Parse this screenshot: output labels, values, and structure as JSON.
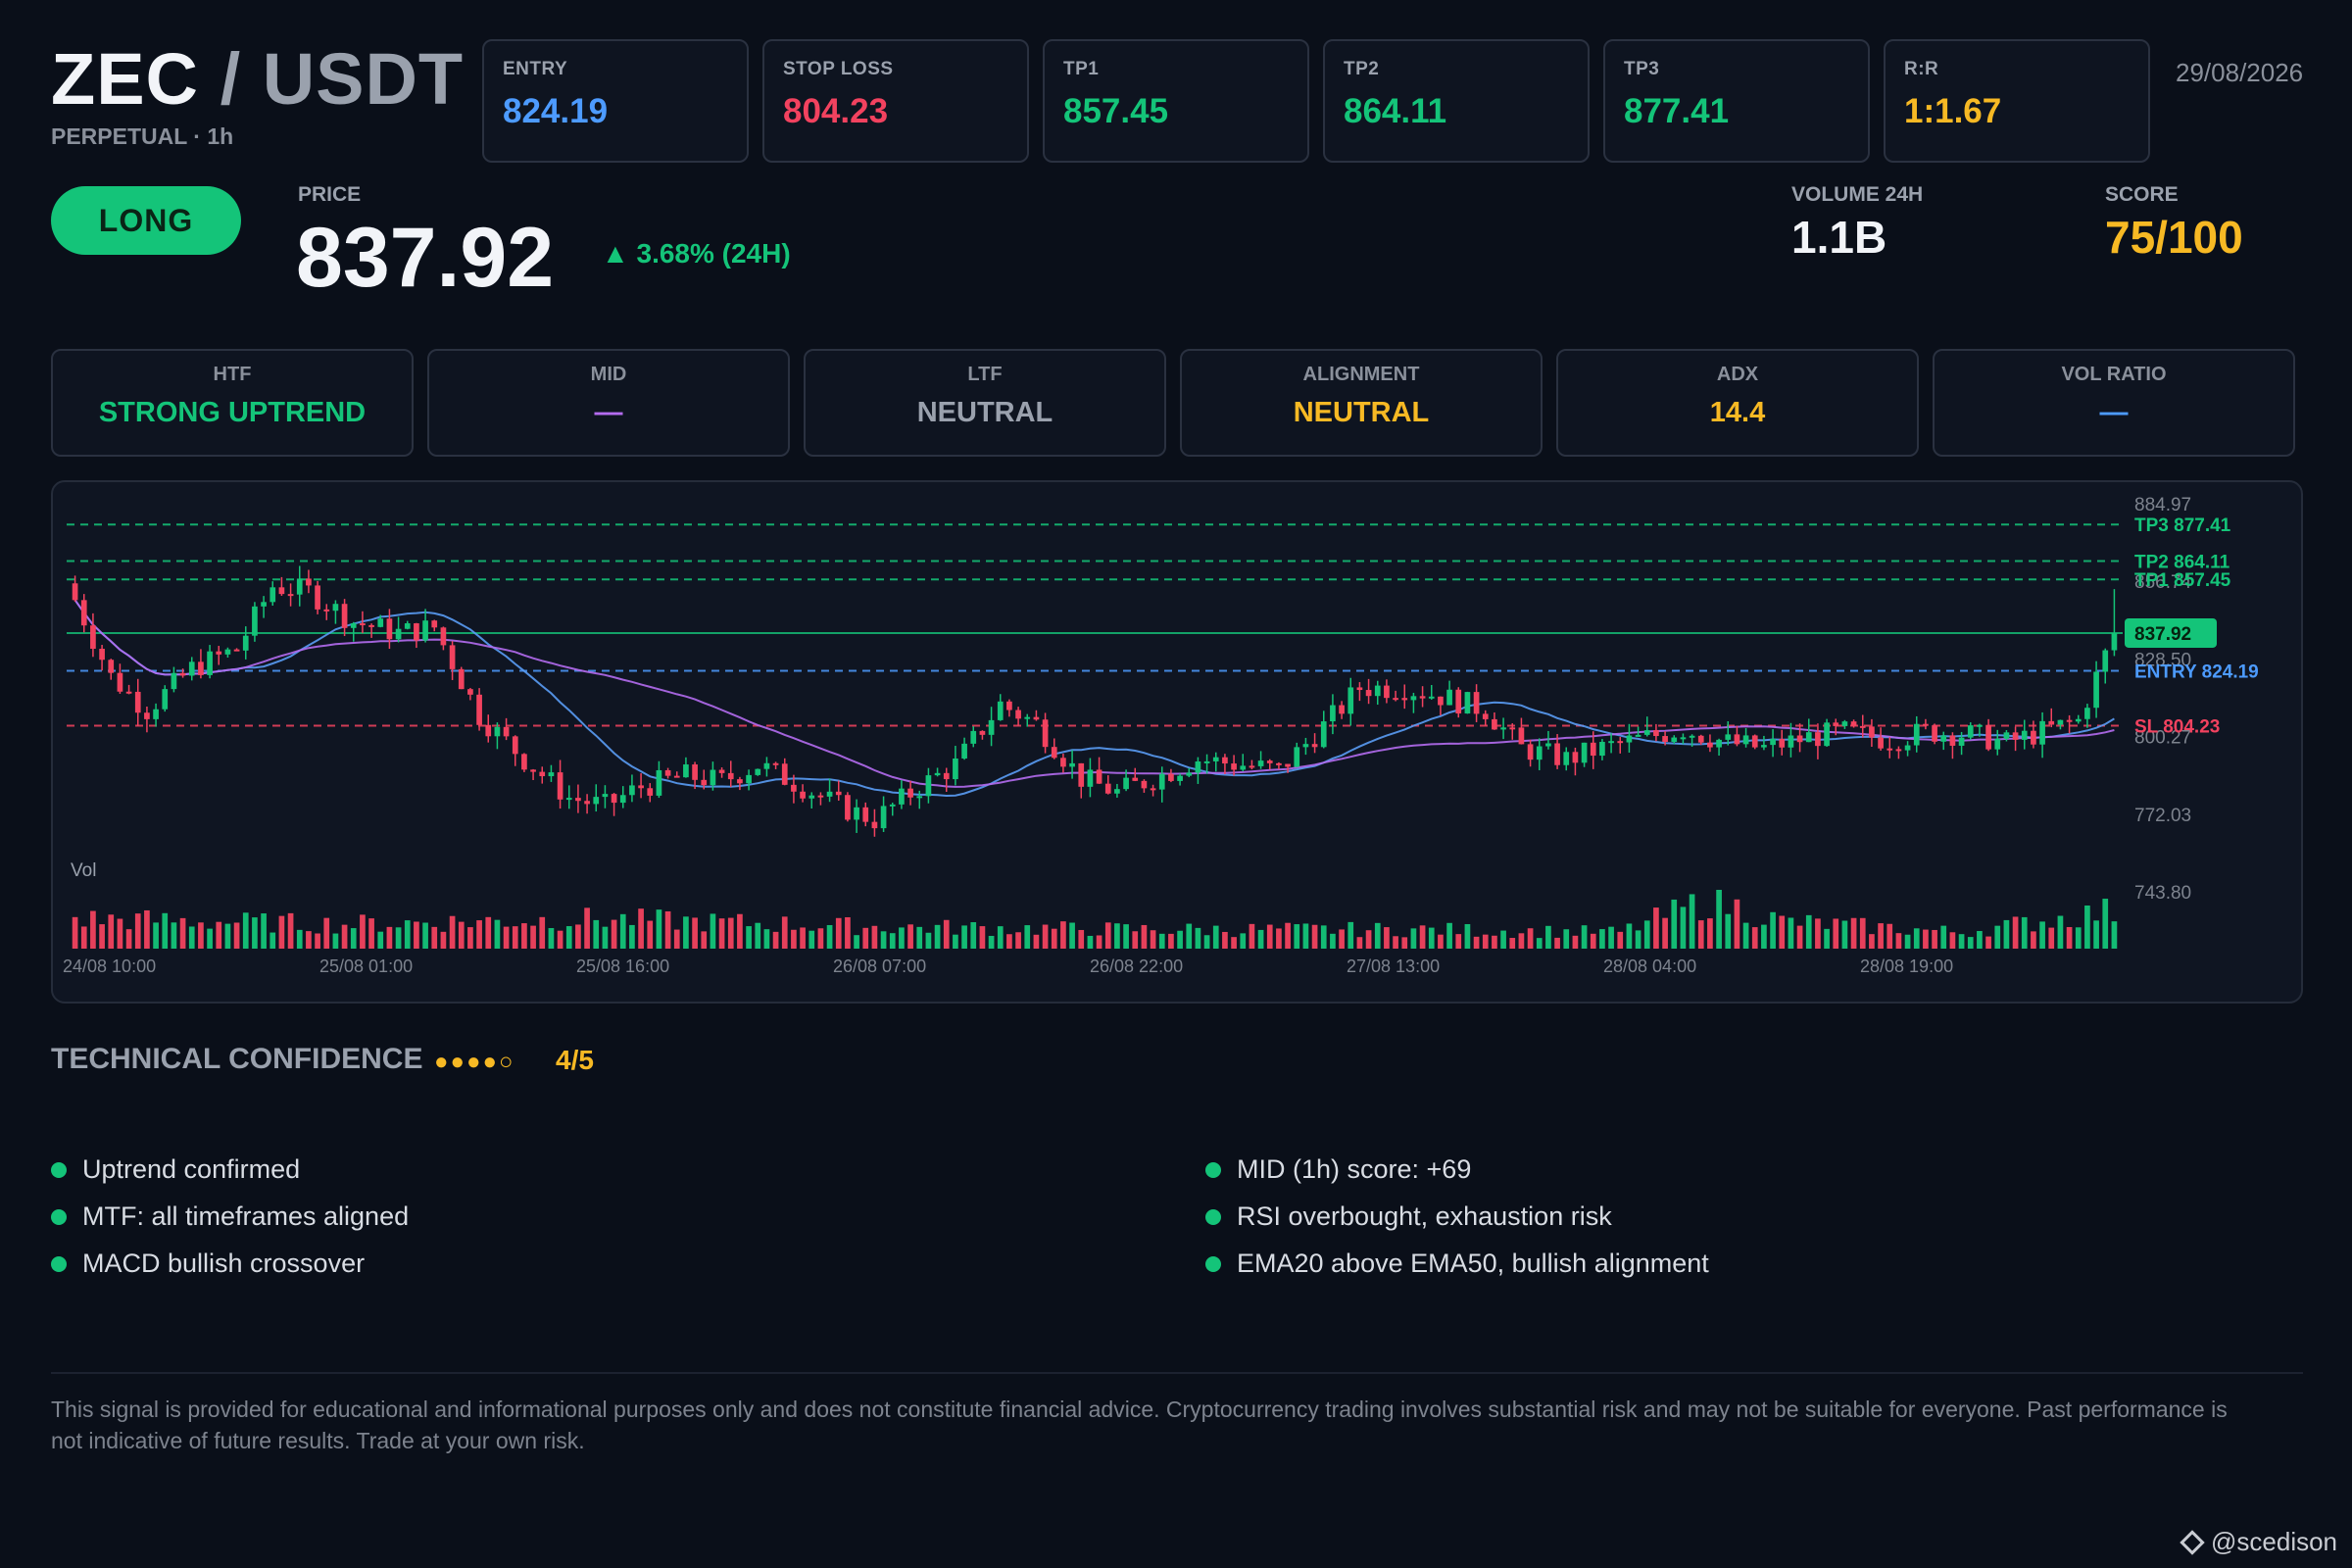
{
  "header": {
    "base": "ZEC",
    "separator": "/",
    "quote": "USDT",
    "subtitle": "PERPETUAL · 1h",
    "date": "29/08/2026"
  },
  "levels": [
    {
      "label": "ENTRY",
      "value": "824.19",
      "color": "#4d9bff"
    },
    {
      "label": "STOP LOSS",
      "value": "804.23",
      "color": "#f2425f"
    },
    {
      "label": "TP1",
      "value": "857.45",
      "color": "#14c479"
    },
    {
      "label": "TP2",
      "value": "864.11",
      "color": "#14c479"
    },
    {
      "label": "TP3",
      "value": "877.41",
      "color": "#14c479"
    },
    {
      "label": "R:R",
      "value": "1:1.67",
      "color": "#f7b924"
    }
  ],
  "signal": {
    "direction": "LONG",
    "price_label": "PRICE",
    "price": "837.92",
    "change": "▲ 3.68% (24H)",
    "volume_label": "VOLUME 24H",
    "volume": "1.1B",
    "score_label": "SCORE",
    "score": "75/100"
  },
  "indicators": [
    {
      "label": "HTF",
      "value": "STRONG UPTREND",
      "color": "#14c479"
    },
    {
      "label": "MID",
      "value": "—",
      "color": "#b46cf0"
    },
    {
      "label": "LTF",
      "value": "NEUTRAL",
      "color": "#9aa1ad"
    },
    {
      "label": "ALIGNMENT",
      "value": "NEUTRAL",
      "color": "#f7b924"
    },
    {
      "label": "ADX",
      "value": "14.4",
      "color": "#f7b924"
    },
    {
      "label": "VOL RATIO",
      "value": "—",
      "color": "#4d9bff"
    }
  ],
  "chart_data": {
    "type": "candlestick",
    "y_axis_ticks": [
      "884.97",
      "856.74",
      "828.50",
      "800.27",
      "772.03",
      "743.80"
    ],
    "x_axis_ticks": [
      "24/08 10:00",
      "25/08 01:00",
      "25/08 16:00",
      "26/08 07:00",
      "26/08 22:00",
      "27/08 13:00",
      "28/08 04:00",
      "28/08 19:00"
    ],
    "ylim": [
      743.8,
      884.97
    ],
    "volume_label": "Vol",
    "levels": [
      {
        "label": "TP3 877.41",
        "value": 877.41,
        "color": "#14c479"
      },
      {
        "label": "TP2 864.11",
        "value": 864.11,
        "color": "#14c479"
      },
      {
        "label": "TP1 857.45",
        "value": 857.45,
        "color": "#14c479"
      },
      {
        "label": "ENTRY 824.19",
        "value": 824.19,
        "color": "#4d9bff"
      },
      {
        "label": "SL 804.23",
        "value": 804.23,
        "color": "#f2425f"
      }
    ],
    "last_price": {
      "label": "837.92",
      "value": 837.92
    },
    "close_anchors": [
      [
        0,
        850
      ],
      [
        4,
        822
      ],
      [
        8,
        810
      ],
      [
        13,
        825
      ],
      [
        18,
        832
      ],
      [
        22,
        855
      ],
      [
        26,
        853
      ],
      [
        31,
        842
      ],
      [
        36,
        838
      ],
      [
        40,
        840
      ],
      [
        45,
        808
      ],
      [
        50,
        792
      ],
      [
        55,
        778
      ],
      [
        59,
        775
      ],
      [
        63,
        782
      ],
      [
        68,
        786
      ],
      [
        72,
        784
      ],
      [
        76,
        790
      ],
      [
        81,
        782
      ],
      [
        85,
        775
      ],
      [
        89,
        770
      ],
      [
        94,
        782
      ],
      [
        98,
        790
      ],
      [
        103,
        812
      ],
      [
        107,
        805
      ],
      [
        112,
        785
      ],
      [
        116,
        780
      ],
      [
        120,
        785
      ],
      [
        125,
        792
      ],
      [
        130,
        790
      ],
      [
        134,
        788
      ],
      [
        139,
        804
      ],
      [
        143,
        818
      ],
      [
        148,
        818
      ],
      [
        152,
        815
      ],
      [
        157,
        810
      ],
      [
        161,
        796
      ],
      [
        166,
        792
      ],
      [
        170,
        796
      ],
      [
        175,
        800
      ],
      [
        179,
        803
      ],
      [
        184,
        798
      ],
      [
        188,
        796
      ],
      [
        193,
        800
      ],
      [
        197,
        802
      ],
      [
        202,
        799
      ],
      [
        206,
        802
      ],
      [
        211,
        801
      ],
      [
        215,
        798
      ],
      [
        219,
        802
      ],
      [
        223,
        806
      ],
      [
        227,
        837.92
      ]
    ],
    "volume_profile": [
      [
        0,
        0.55
      ],
      [
        30,
        0.45
      ],
      [
        58,
        0.55
      ],
      [
        90,
        0.4
      ],
      [
        120,
        0.35
      ],
      [
        150,
        0.35
      ],
      [
        172,
        0.3
      ],
      [
        182,
        0.9
      ],
      [
        190,
        0.5
      ],
      [
        210,
        0.3
      ],
      [
        227,
        0.7
      ]
    ]
  },
  "confidence": {
    "title": "TECHNICAL CONFIDENCE",
    "dots": "●●●●○",
    "score": "4/5"
  },
  "reasons": [
    "Uptrend confirmed",
    "MTF: all timeframes aligned",
    "MACD bullish crossover",
    "MID (1h) score: +69",
    "RSI overbought, exhaustion risk",
    "EMA20 above EMA50, bullish alignment"
  ],
  "disclaimer": "This signal is provided for educational and informational purposes only and does not constitute financial advice. Cryptocurrency trading involves substantial risk and may not be suitable for everyone. Past performance is not indicative of future results. Trade at your own risk.",
  "watermark": "@scedison"
}
